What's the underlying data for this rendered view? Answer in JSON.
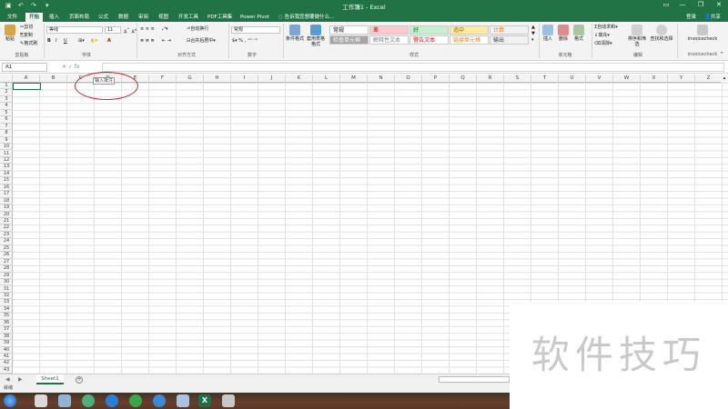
{
  "window": {
    "title": "工作簿1 - Excel"
  },
  "tabs": [
    "文件",
    "开始",
    "插入",
    "页面布局",
    "公式",
    "数据",
    "审阅",
    "视图",
    "开发工具",
    "PDF工具集",
    "Power Pivot"
  ],
  "active_tab": "开始",
  "tell_me": "告诉我您想要做什么...",
  "account": {
    "login": "登录",
    "share": "共享"
  },
  "clipboard": {
    "paste": "粘贴",
    "cut": "剪切",
    "copy": "复制",
    "format_painter": "格式刷",
    "label": "剪贴板"
  },
  "font": {
    "name": "等线",
    "size": "11",
    "bold": "B",
    "italic": "I",
    "underline": "U",
    "font_color": "A",
    "label": "字体"
  },
  "alignment": {
    "wrap": "自动换行",
    "merge": "合并后居中",
    "label": "对齐方式"
  },
  "number": {
    "format": "常规",
    "label": "数字"
  },
  "styles": {
    "conditional": "条件格式",
    "table": "套用表格格式",
    "cells": [
      {
        "text": "常规",
        "bg": "#ffffff",
        "color": "#000000"
      },
      {
        "text": "差",
        "bg": "#ffc7ce",
        "color": "#9c0006"
      },
      {
        "text": "好",
        "bg": "#c6efce",
        "color": "#006100"
      },
      {
        "text": "适中",
        "bg": "#ffeb9c",
        "color": "#9c5700"
      },
      {
        "text": "计算",
        "bg": "#f2f2f2",
        "color": "#fa7d00"
      },
      {
        "text": "检查单元格",
        "bg": "#a5a5a5",
        "color": "#ffffff"
      },
      {
        "text": "解释性文本",
        "bg": "#ffffff",
        "color": "#7f7f7f"
      },
      {
        "text": "警告文本",
        "bg": "#ffffff",
        "color": "#ff0000"
      },
      {
        "text": "链接单元格",
        "bg": "#ffffff",
        "color": "#fa7d00"
      },
      {
        "text": "输出",
        "bg": "#f2f2f2",
        "color": "#3f3f3f"
      }
    ],
    "label": "样式"
  },
  "cells_group": {
    "insert": "插入",
    "delete": "删除",
    "format": "格式",
    "label": "单元格"
  },
  "editing": {
    "autosum": "自动求和",
    "fill": "填充",
    "clear": "清除",
    "sort": "排序和筛选",
    "find": "查找和选择",
    "label": "编辑"
  },
  "addin": {
    "name": "invoicecheck",
    "label": "invoicecheck"
  },
  "formula_bar": {
    "name_box": "A1",
    "fx": "fx",
    "value": ""
  },
  "columns": [
    "A",
    "B",
    "C",
    "D",
    "E",
    "F",
    "G",
    "H",
    "I",
    "J",
    "K",
    "L",
    "M",
    "N",
    "O",
    "P",
    "Q",
    "R",
    "S",
    "T",
    "U",
    "V",
    "W",
    "X",
    "Y",
    "Z"
  ],
  "rows": [
    "1",
    "2",
    "3",
    "4",
    "5",
    "6",
    "7",
    "8",
    "9",
    "10",
    "11",
    "12",
    "13",
    "14",
    "15",
    "16",
    "17",
    "18",
    "19",
    "20",
    "21",
    "22",
    "23",
    "24",
    "25",
    "26",
    "27",
    "28",
    "29",
    "30",
    "31",
    "32",
    "33",
    "34",
    "35",
    "36",
    "37",
    "38",
    "39",
    "40",
    "41",
    "42",
    "43"
  ],
  "comment_box": "输入批注",
  "sheet_tabs": [
    "Sheet1"
  ],
  "status": "就绪",
  "watermark": "软件技巧",
  "colors": {
    "excel_green": "#217346",
    "annotation_red": "#c0282d"
  }
}
